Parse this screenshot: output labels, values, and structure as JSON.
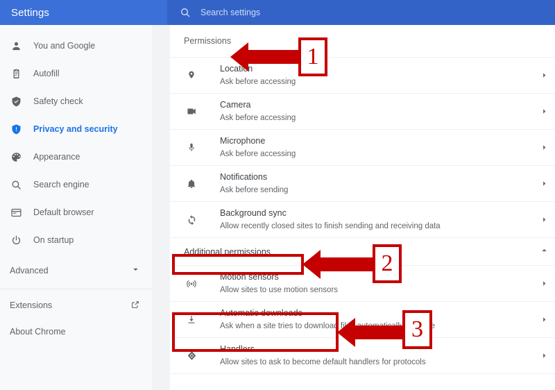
{
  "header": {
    "title": "Settings",
    "search_placeholder": "Search settings",
    "search_icon": "search-icon",
    "bar_color": "#3b70d8",
    "search_bg_color": "#3463c8"
  },
  "sidebar": {
    "items": [
      {
        "label": "You and Google",
        "icon": "person-icon",
        "active": false
      },
      {
        "label": "Autofill",
        "icon": "clipboard-icon",
        "active": false
      },
      {
        "label": "Safety check",
        "icon": "shield-check-icon",
        "active": false
      },
      {
        "label": "Privacy and security",
        "icon": "shield-icon",
        "active": true
      },
      {
        "label": "Appearance",
        "icon": "palette-icon",
        "active": false
      },
      {
        "label": "Search engine",
        "icon": "search-icon",
        "active": false
      },
      {
        "label": "Default browser",
        "icon": "browser-window-icon",
        "active": false
      },
      {
        "label": "On startup",
        "icon": "power-icon",
        "active": false
      }
    ],
    "advanced": {
      "label": "Advanced",
      "icon": "chevron-down-icon"
    },
    "footer": [
      {
        "label": "Extensions",
        "icon": "external-link-icon"
      },
      {
        "label": "About Chrome",
        "icon": ""
      }
    ],
    "active_color": "#1a73e8"
  },
  "main": {
    "section_title": "Permissions",
    "permissions": [
      {
        "title": "Location",
        "sub": "Ask before accessing",
        "icon": "location-pin-icon"
      },
      {
        "title": "Camera",
        "sub": "Ask before accessing",
        "icon": "video-camera-icon"
      },
      {
        "title": "Microphone",
        "sub": "Ask before accessing",
        "icon": "microphone-icon"
      },
      {
        "title": "Notifications",
        "sub": "Ask before sending",
        "icon": "bell-icon"
      },
      {
        "title": "Background sync",
        "sub": "Allow recently closed sites to finish sending and receiving data",
        "icon": "sync-icon"
      }
    ],
    "additional_group": {
      "label": "Additional permissions",
      "icon": "chevron-up-icon",
      "expanded": true
    },
    "additional_permissions": [
      {
        "title": "Motion sensors",
        "sub": "Allow sites to use motion sensors",
        "icon": "motion-sensor-icon"
      },
      {
        "title": "Automatic downloads",
        "sub": "Ask when a site tries to download files automatically after the",
        "icon": "download-icon"
      },
      {
        "title": "Handlers",
        "sub": "Allow sites to ask to become default handlers for protocols",
        "icon": "handlers-icon"
      }
    ],
    "row_chevron_icon": "chevron-right-icon"
  },
  "annotations": {
    "color": "#c50000",
    "callouts": [
      {
        "number": "1",
        "target": "Permissions"
      },
      {
        "number": "2",
        "target": "Additional permissions"
      },
      {
        "number": "3",
        "target": "Automatic downloads"
      }
    ]
  }
}
